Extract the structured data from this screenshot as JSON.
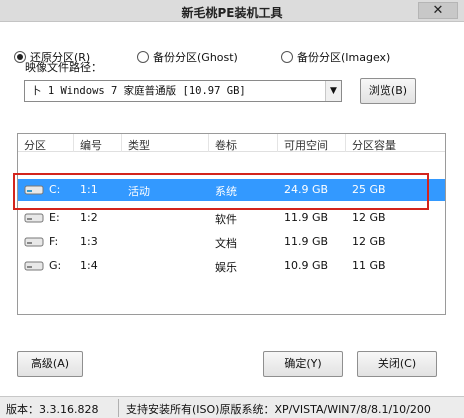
{
  "window": {
    "title": "新毛桃PE装机工具",
    "close_glyph": "✕"
  },
  "modes": [
    {
      "label": "还原分区(R)",
      "selected": true
    },
    {
      "label": "备份分区(Ghost)",
      "selected": false
    },
    {
      "label": "备份分区(Imagex)",
      "selected": false
    }
  ],
  "image_path": {
    "label": "映像文件路径：",
    "value": "卜 1 Windows 7 家庭普通版 [10.97 GB]",
    "dropdown_glyph": "▼",
    "browse_label": "浏览(B)"
  },
  "table": {
    "columns": [
      "分区",
      "编号",
      "类型",
      "卷标",
      "可用空间",
      "分区容量"
    ],
    "rows": [
      {
        "drive": "C:",
        "number": "1:1",
        "type": "活动",
        "label": "系统",
        "free": "24.9 GB",
        "capacity": "25 GB",
        "selected": true
      },
      {
        "drive": "E:",
        "number": "1:2",
        "type": "",
        "label": "软件",
        "free": "11.9 GB",
        "capacity": "12 GB",
        "selected": false
      },
      {
        "drive": "F:",
        "number": "1:3",
        "type": "",
        "label": "文档",
        "free": "11.9 GB",
        "capacity": "12 GB",
        "selected": false
      },
      {
        "drive": "G:",
        "number": "1:4",
        "type": "",
        "label": "娱乐",
        "free": "10.9 GB",
        "capacity": "11 GB",
        "selected": false
      }
    ]
  },
  "buttons": {
    "advanced": "高级(A)",
    "ok": "确定(Y)",
    "close": "关闭(C)"
  },
  "status": {
    "version": "版本：3.3.16.828",
    "support": "支持安装所有(ISO)原版系统：XP/VISTA/WIN7/8/8.1/10/200"
  },
  "colors": {
    "selection": "#3399ff",
    "annotation_box": "#d3241c"
  }
}
